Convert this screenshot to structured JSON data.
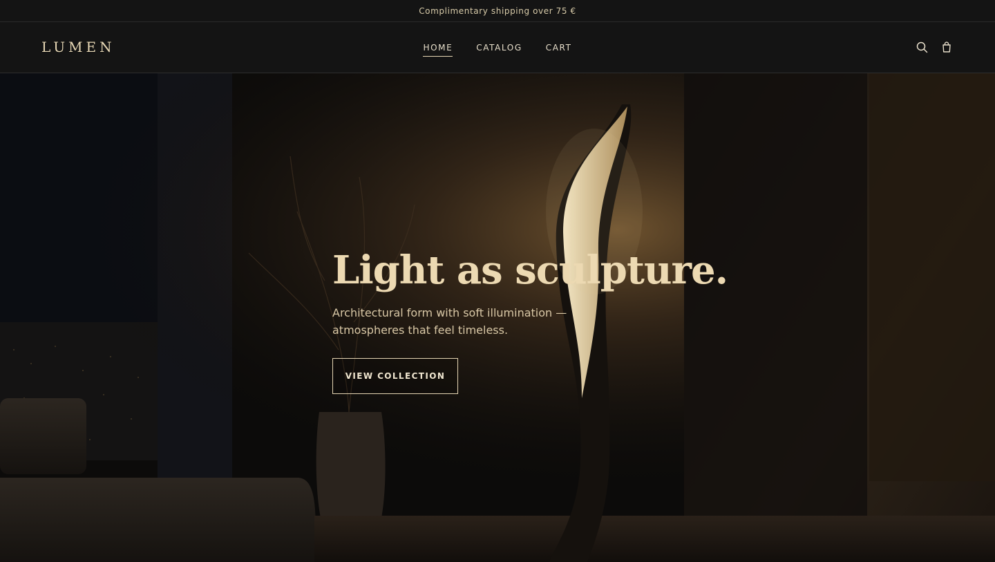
{
  "announcement": "Complimentary shipping over 75 €",
  "brand": "LUMEN",
  "nav": [
    {
      "label": "HOME",
      "active": true
    },
    {
      "label": "CATALOG",
      "active": false
    },
    {
      "label": "CART",
      "active": false
    }
  ],
  "icons": {
    "search": "search-icon",
    "cart": "shopping-bag-icon"
  },
  "hero": {
    "headline": "Light as sculpture.",
    "subtitle": "Architectural form with soft illumination — atmospheres that feel timeless.",
    "cta": "VIEW COLLECTION"
  },
  "colors": {
    "accent": "#ecd9b2",
    "background": "#111111"
  }
}
